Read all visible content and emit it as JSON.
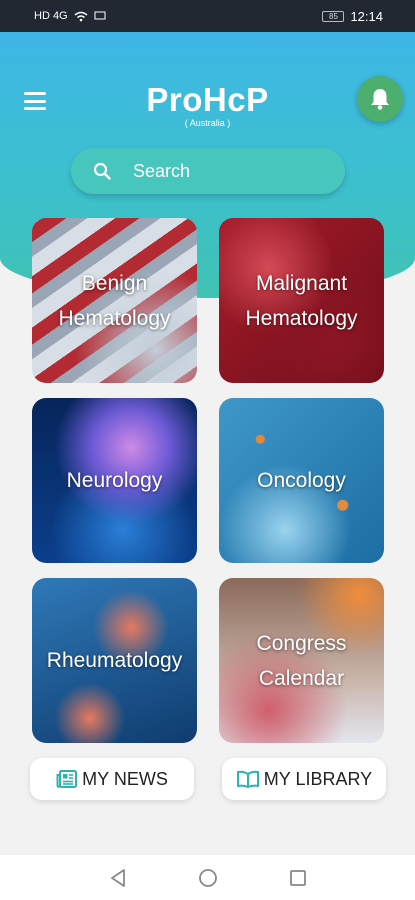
{
  "status_bar": {
    "time": "12:14",
    "battery": "85",
    "signal_text": "HD 4G"
  },
  "header": {
    "app_title": "ProHcP",
    "app_subtitle": "( Australia )"
  },
  "search": {
    "placeholder": "Search"
  },
  "categories": [
    {
      "label_line1": "Benign",
      "label_line2": "Hematology"
    },
    {
      "label_line1": "Malignant",
      "label_line2": "Hematology"
    },
    {
      "label_line1": "Neurology",
      "label_line2": ""
    },
    {
      "label_line1": "Oncology",
      "label_line2": ""
    },
    {
      "label_line1": "Rheumatology",
      "label_line2": ""
    },
    {
      "label_line1": "Congress",
      "label_line2": "Calendar"
    }
  ],
  "bottom_buttons": {
    "news_label": "MY NEWS",
    "library_label": "MY LIBRARY"
  },
  "icons": [
    "menu-icon",
    "bell-icon",
    "search-icon",
    "newspaper-icon",
    "book-icon",
    "back-icon",
    "home-icon",
    "recents-icon"
  ],
  "colors": {
    "hero_top": "#3fb6e6",
    "hero_bottom": "#40c2b2",
    "bell_bg": "#4caf6e",
    "icon_teal": "#2bb3b0"
  }
}
